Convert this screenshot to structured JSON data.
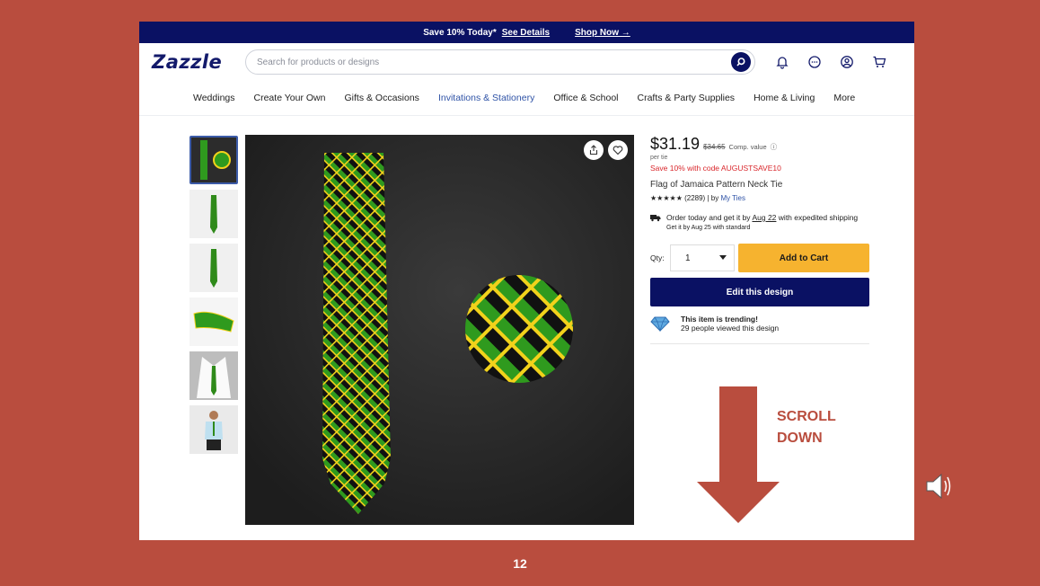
{
  "promo": {
    "text": "Save 10% Today*",
    "details_link": "See Details",
    "shop_link": "Shop Now →"
  },
  "header": {
    "logo": "Zazzle",
    "search_placeholder": "Search for products or designs"
  },
  "nav": [
    "Weddings",
    "Create Your Own",
    "Gifts & Occasions",
    "Invitations & Stationery",
    "Office & School",
    "Crafts & Party Supplies",
    "Home & Living",
    "More"
  ],
  "nav_active_index": 3,
  "product": {
    "price": "$31.19",
    "old_price": "$34.65",
    "comp_value": "Comp. value",
    "per": "per tie",
    "save_code": "Save 10% with code AUGUSTSAVE10",
    "name": "Flag of Jamaica Pattern Neck Tie",
    "stars": "★★★★★",
    "reviews": "(2289)",
    "by": "| by",
    "seller": "My Ties",
    "ship_text_1": "Order today and get it by",
    "ship_date": "Aug 22",
    "ship_text_2": "with expedited shipping",
    "ship_standard": "Get it by Aug 25 with standard",
    "qty_label": "Qty:",
    "qty_value": "1",
    "add_to_cart": "Add to Cart",
    "edit_design": "Edit this design",
    "trend_title": "This item is trending!",
    "trend_sub": "29 people viewed this design"
  },
  "slide": {
    "scroll_line1": "SCROLL",
    "scroll_line2": "DOWN",
    "page_number": "12"
  },
  "colors": {
    "brand_navy": "#0a1163",
    "cart_yellow": "#f6b32f",
    "slide_bg": "#b94d3e",
    "tie_green": "#2f9a1e",
    "tie_yellow": "#f2d21b"
  }
}
